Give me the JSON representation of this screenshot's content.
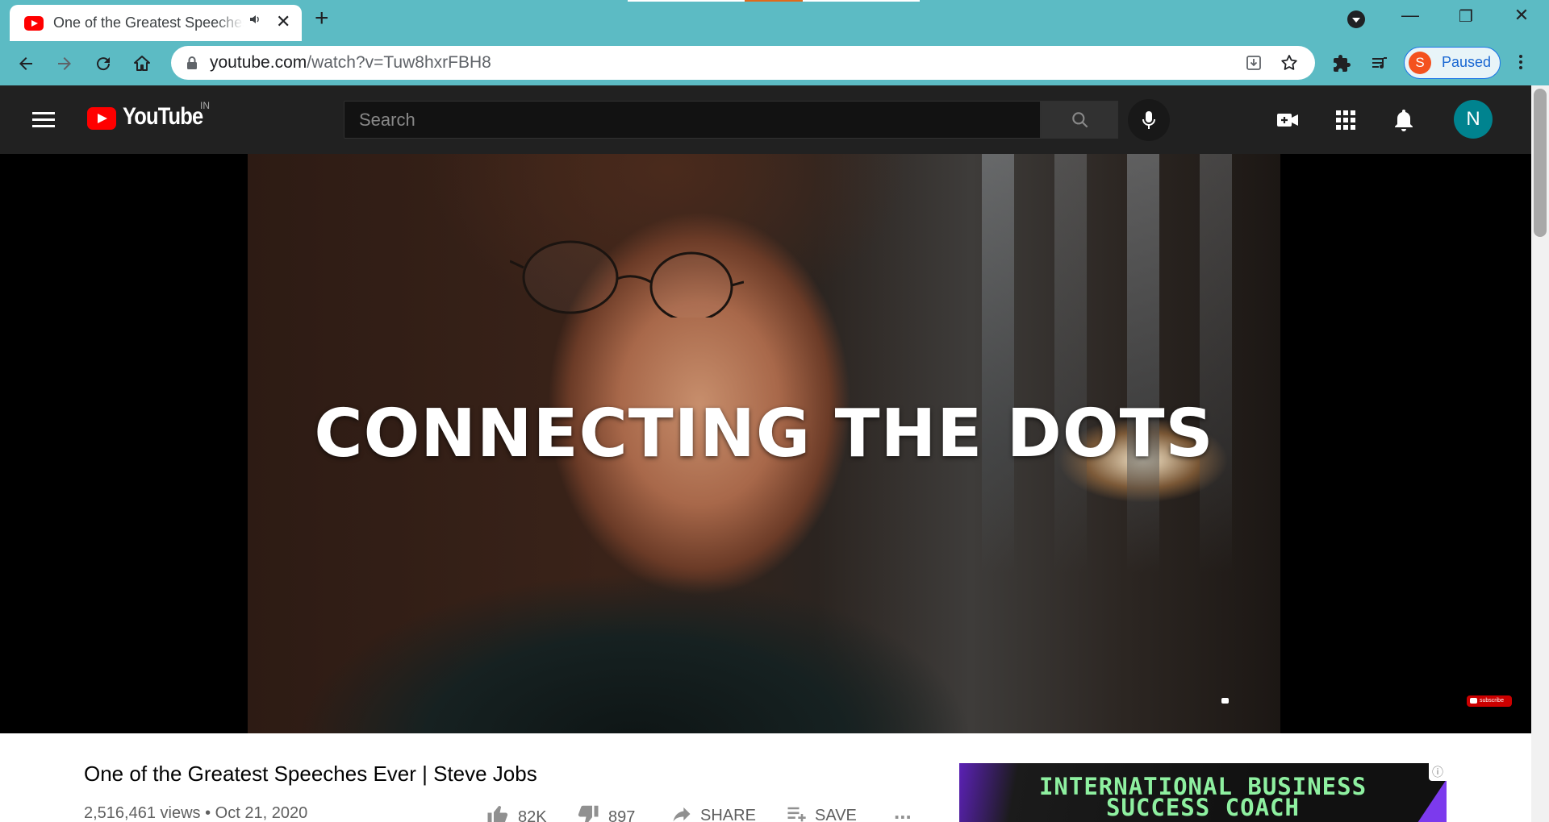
{
  "browser": {
    "tab": {
      "title": "One of the Greatest Speeches Ever | Steve Jobs",
      "favicon": "youtube-favicon",
      "audio_icon": "speaker-icon"
    },
    "address": {
      "host": "youtube.com",
      "path": "/watch?v=Tuw8hxrFBH8"
    },
    "profile": {
      "initial": "S",
      "status": "Paused"
    },
    "theme_color": "#5cbbc4"
  },
  "youtube": {
    "logo_text": "YouTube",
    "country_code": "IN",
    "search": {
      "placeholder": "Search",
      "value": ""
    },
    "account_initial": "N",
    "header_icons": [
      "menu-icon",
      "search-icon",
      "microphone-icon",
      "create-video-icon",
      "apps-grid-icon",
      "notifications-bell-icon"
    ]
  },
  "video": {
    "caption": "CONNECTING THE DOTS",
    "subscribe_badge": "subscribe",
    "title": "One of the Greatest Speeches Ever | Steve Jobs",
    "views": "2,516,461 views",
    "date": "Oct 21, 2020",
    "likes": "82K",
    "dislikes": "897",
    "share_label": "SHARE",
    "save_label": "SAVE",
    "more_label": "..."
  },
  "ad": {
    "line1": "INTERNATIONAL BUSINESS",
    "line2": "SUCCESS COACH",
    "info": "ⓘ"
  }
}
